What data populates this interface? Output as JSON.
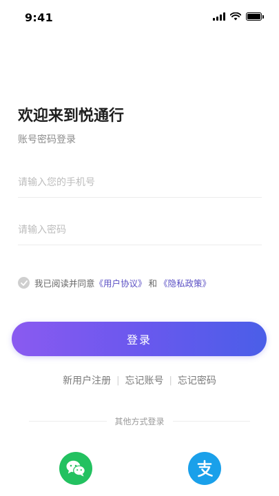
{
  "status_bar": {
    "time": "9:41"
  },
  "login": {
    "title": "欢迎来到悦通行",
    "subtitle": "账号密码登录",
    "phone_placeholder": "请输入您的手机号",
    "password_placeholder": "请输入密码",
    "agreement": {
      "prefix": "我已阅读并同意",
      "user_agreement": "《用户协议》",
      "conjunction": "和",
      "privacy_policy": "《隐私政策》",
      "checked": false
    },
    "submit_label": "登录",
    "links": {
      "register": "新用户注册",
      "forgot_account": "忘记账号",
      "forgot_password": "忘记密码"
    },
    "other_methods_label": "其他方式登录",
    "social": [
      {
        "name": "wechat",
        "icon": "wechat-icon",
        "color": "#23c160"
      },
      {
        "name": "alipay",
        "icon": "alipay-icon",
        "color": "#1aa0ea"
      }
    ]
  },
  "colors": {
    "accent_start": "#8a5af0",
    "accent_end": "#4a5ee8",
    "link": "#5a4fc4"
  }
}
